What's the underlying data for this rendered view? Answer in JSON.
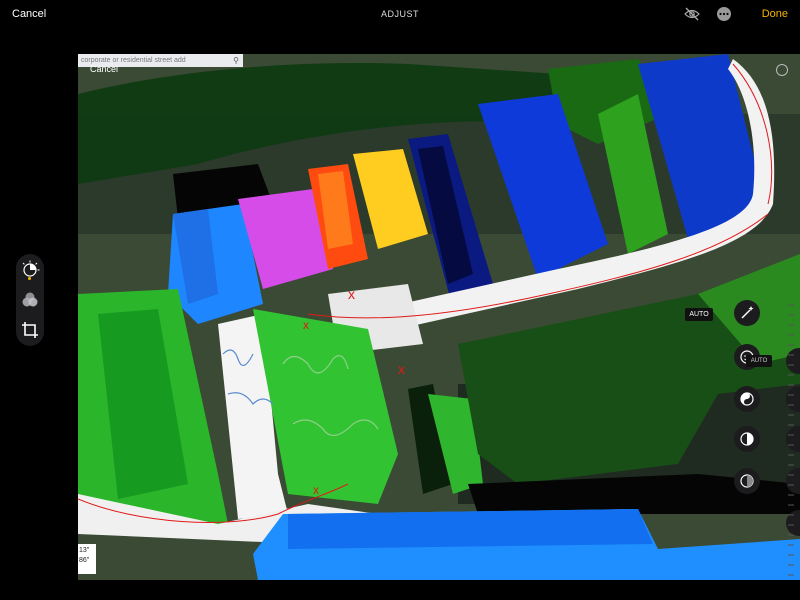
{
  "topbar": {
    "cancel_label": "Cancel",
    "title": "ADJUST",
    "done_label": "Done",
    "accent_color": "#f5b400",
    "icons": [
      "eye-slash-icon",
      "more-icon"
    ]
  },
  "photo": {
    "search_placeholder": "corporate or residential street add",
    "inner_cancel_label": "Cancel",
    "scale_top": "13\"",
    "scale_bottom": "86\""
  },
  "tools": [
    "adjust-dial-icon",
    "filters-icon",
    "crop-icon"
  ],
  "adjust": {
    "auto_label": "AUTO",
    "auto_label_small": "AUTO",
    "controls": [
      "magic-wand-icon",
      "exposure-icon",
      "brilliance-icon",
      "highlights-icon",
      "shadows-icon"
    ]
  }
}
